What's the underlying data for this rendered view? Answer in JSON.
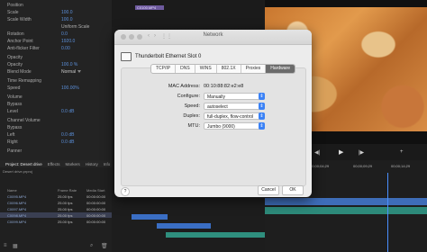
{
  "effects": {
    "rows": [
      {
        "label": "Position",
        "value": ""
      },
      {
        "label": "Scale",
        "value": "100.0"
      },
      {
        "label": "Scale Width",
        "value": "100.0"
      },
      {
        "label": "",
        "value": "Uniform Scale"
      },
      {
        "label": "Rotation",
        "value": "0.0"
      },
      {
        "label": "Anchor Point",
        "value": "1920.0"
      },
      {
        "label": "Anti-flicker Filter",
        "value": "0.00"
      },
      {
        "label": "Opacity",
        "value": ""
      },
      {
        "label": "Opacity",
        "value": "100.0 %"
      },
      {
        "label": "Blend Mode",
        "value": "Normal"
      },
      {
        "label": "Time Remapping",
        "value": ""
      },
      {
        "label": "Speed",
        "value": "100.00%"
      },
      {
        "label": "Volume",
        "value": ""
      },
      {
        "label": "Bypass",
        "value": ""
      },
      {
        "label": "Level",
        "value": "0.0 dB"
      },
      {
        "label": "Channel Volume",
        "value": ""
      },
      {
        "label": "Bypass",
        "value": ""
      },
      {
        "label": "Left",
        "value": "0.0 dB"
      },
      {
        "label": "Right",
        "value": "0.0 dB"
      },
      {
        "label": "Panner",
        "value": ""
      }
    ]
  },
  "sequence_clip": "C0100.MP4",
  "project": {
    "tabs": [
      {
        "label": "Project: Desert drive",
        "active": true
      },
      {
        "label": "Effects",
        "active": false
      },
      {
        "label": "Markers",
        "active": false
      },
      {
        "label": "History",
        "active": false
      },
      {
        "label": "Info",
        "active": false
      }
    ],
    "path": "Desert drive.prproj",
    "columns": [
      "Name",
      "Frame Rate",
      "Media Start"
    ],
    "rows": [
      {
        "name": "C0095.MP4",
        "rate": "25.00 fps",
        "start": "00:00:00:00",
        "selected": false
      },
      {
        "name": "C0096.MP4",
        "rate": "25.00 fps",
        "start": "00:00:00:00",
        "selected": false
      },
      {
        "name": "C0097.MP4",
        "rate": "25.00 fps",
        "start": "00:00:00:00",
        "selected": false
      },
      {
        "name": "C0098.MP4",
        "rate": "25.00 fps",
        "start": "00:00:00:00",
        "selected": true
      },
      {
        "name": "C0099.MP4",
        "rate": "25.00 fps",
        "start": "00:00:00:00",
        "selected": false
      }
    ]
  },
  "dialog": {
    "title": "Network",
    "interface_name": "Thunderbolt Ethernet Slot 0",
    "tabs": [
      {
        "label": "TCP/IP",
        "active": false
      },
      {
        "label": "DNS",
        "active": false
      },
      {
        "label": "WINS",
        "active": false
      },
      {
        "label": "802.1X",
        "active": false
      },
      {
        "label": "Proxies",
        "active": false
      },
      {
        "label": "Hardware",
        "active": true
      }
    ],
    "mac_label": "MAC Address:",
    "mac_value": "00:10:88:82:e2:e8",
    "configure_label": "Configure:",
    "configure_value": "Manually",
    "speed_label": "Speed:",
    "speed_value": "autoselect",
    "duplex_label": "Duplex:",
    "duplex_value": "full-duplex, flow-control",
    "mtu_label": "MTU:",
    "mtu_value": "Jumbo (9000)",
    "help_label": "?",
    "cancel_label": "Cancel",
    "ok_label": "OK"
  },
  "timeline": {
    "timecodes": [
      "00;00;00;00",
      "00;00;04;29",
      "00;00;09;29",
      "00;00;14;29"
    ]
  }
}
